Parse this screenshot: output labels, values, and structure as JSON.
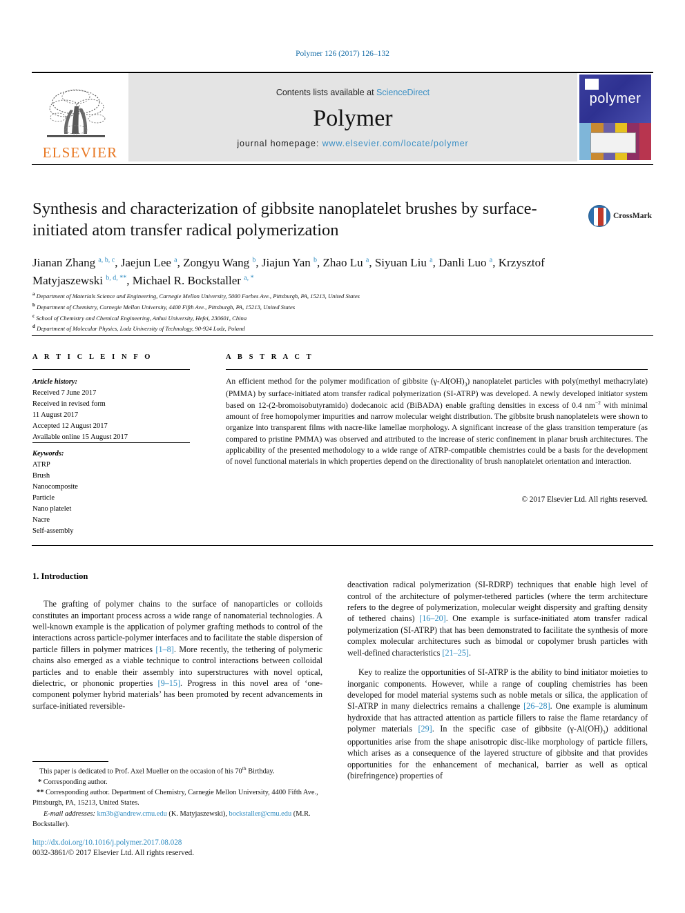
{
  "running_head": "Polymer 126 (2017) 126–132",
  "masthead": {
    "publisher_name": "ELSEVIER",
    "contents_prefix": "Contents lists available at ",
    "contents_link": "ScienceDirect",
    "journal_title": "Polymer",
    "homepage_prefix": "journal homepage: ",
    "homepage_url": "www.elsevier.com/locate/polymer",
    "cover_word": "polymer"
  },
  "article": {
    "title": "Synthesis and characterization of gibbsite nanoplatelet brushes by surface-initiated atom transfer radical polymerization",
    "crossmark_label": "CrossMark",
    "authors_html": "Jianan Zhang <sup>a, b, c</sup>, Jaejun Lee <sup>a</sup>, Zongyu Wang <sup>b</sup>, Jiajun Yan <sup>b</sup>, Zhao Lu <sup>a</sup>, Siyuan Liu <sup>a</sup>, Danli Luo <sup>a</sup>, Krzysztof Matyjaszewski <sup>b, d, **</sup>, Michael R. Bockstaller <sup>a, *</sup>",
    "affiliations": [
      {
        "mark": "a",
        "text": "Department of Materials Science and Engineering, Carnegie Mellon University, 5000 Forbes Ave., Pittsburgh, PA, 15213, United States"
      },
      {
        "mark": "b",
        "text": "Department of Chemistry, Carnegie Mellon University, 4400 Fifth Ave., Pittsburgh, PA, 15213, United States"
      },
      {
        "mark": "c",
        "text": "School of Chemistry and Chemical Engineering, Anhui University, Hefei, 230601, China"
      },
      {
        "mark": "d",
        "text": "Department of Molecular Physics, Lodz University of Technology, 90-924 Lodz, Poland"
      }
    ]
  },
  "article_info": {
    "heading": "A R T I C L E  I N F O",
    "history_label": "Article history:",
    "history": [
      "Received 7 June 2017",
      "Received in revised form",
      "11 August 2017",
      "Accepted 12 August 2017",
      "Available online 15 August 2017"
    ],
    "keywords_label": "Keywords:",
    "keywords": [
      "ATRP",
      "Brush",
      "Nanocomposite",
      "Particle",
      "Nano platelet",
      "Nacre",
      "Self-assembly"
    ]
  },
  "abstract": {
    "heading": "A B S T R A C T",
    "text_html": "An efficient method for the polymer modification of gibbsite (γ-Al(OH)<sub class=\"sm\">3</sub>) nanoplatelet particles with poly(methyl methacrylate) (PMMA) by surface-initiated atom transfer radical polymerization (SI-ATRP) was developed. A newly developed initiator system based on 12-(2-bromoisobutyramido) dodecanoic acid (BiBADA) enable grafting densities in excess of 0.4 nm<sup class=\"sm\">−2</sup> with minimal amount of free homopolymer impurities and narrow molecular weight distribution. The gibbsite brush nanoplatelets were shown to organize into transparent films with nacre-like lamellae morphology. A significant increase of the glass transition temperature (as compared to pristine PMMA) was observed and attributed to the increase of steric confinement in planar brush architectures. The applicability of the presented methodology to a wide range of ATRP-compatible chemistries could be a basis for the development of novel functional materials in which properties depend on the directionality of brush nanoplatelet orientation and interaction.",
    "copyright": "© 2017 Elsevier Ltd. All rights reserved."
  },
  "body": {
    "section_number_title": "1. Introduction",
    "left_column_html": "<p class=\"indent\">The grafting of polymer chains to the surface of nanoparticles or colloids constitutes an important process across a wide range of nanomaterial technologies. A well-known example is the application of polymer grafting methods to control of the interactions across particle-polymer interfaces and to facilitate the stable dispersion of particle fillers in polymer matrices <span class=\"ref\">[1–8]</span>. More recently, the tethering of polymeric chains also emerged as a viable technique to control interactions between colloidal particles and to enable their assembly into superstructures with novel optical, dielectric, or phononic properties <span class=\"ref\">[9–15]</span>. Progress in this novel area of ‘one-component polymer hybrid materials’ has been promoted by recent advancements in surface-initiated reversible-</p>",
    "right_column_html": "<p>deactivation radical polymerization (SI-RDRP) techniques that enable high level of control of the architecture of polymer-tethered particles (where the term architecture refers to the degree of polymerization, molecular weight dispersity and grafting density of tethered chains) <span class=\"ref\">[16–20]</span>. One example is surface-initiated atom transfer radical polymerization (SI-ATRP) that has been demonstrated to facilitate the synthesis of more complex molecular architectures such as bimodal or copolymer brush particles with well-defined characteristics <span class=\"ref\">[21–25]</span>.</p><p class=\"indent\">Key to realize the opportunities of SI-ATRP is the ability to bind initiator moieties to inorganic components. However, while a range of coupling chemistries has been developed for model material systems such as noble metals or silica, the application of SI-ATRP in many dielectrics remains a challenge <span class=\"ref\">[26–28]</span>. One example is aluminum hydroxide that has attracted attention as particle fillers to raise the flame retardancy of polymer materials <span class=\"ref\">[29]</span>. In the specific case of gibbsite (γ-Al(OH)<sub class=\"sm\">3</sub>) additional opportunities arise from the shape anisotropic disc-like morphology of particle fillers, which arises as a consequence of the layered structure of gibbsite and that provides opportunities for the enhancement of mechanical, barrier as well as optical (birefringence) properties of</p>"
  },
  "footnotes": {
    "dedication_html": "This paper is dedicated to Prof. Axel Mueller on the occasion of his 70<sup class=\"sm\">th</sup> Birthday.",
    "corresponding_1_html": "<span class=\"mark\">*</span> Corresponding author.",
    "corresponding_2_html": "<span class=\"mark\">**</span> Corresponding author. Department of Chemistry, Carnegie Mellon University, 4400 Fifth Ave., Pittsburgh, PA, 15213, United States.",
    "emails_html": "<span class=\"em\">E-mail addresses:</span> <span class=\"link\">km3b@andrew.cmu.edu</span> (K. Matyjaszewski), <span class=\"link\">bockstaller@cmu.edu</span> (M.R. Bockstaller).",
    "doi": "http://dx.doi.org/10.1016/j.polymer.2017.08.028",
    "issn_line": "0032-3861/© 2017 Elsevier Ltd. All rights reserved."
  },
  "colors": {
    "link_blue": "#2e8bc0",
    "elsevier_orange": "#E87722",
    "band_gray": "#e4e4e4",
    "cover_blue": "#2e3191"
  }
}
